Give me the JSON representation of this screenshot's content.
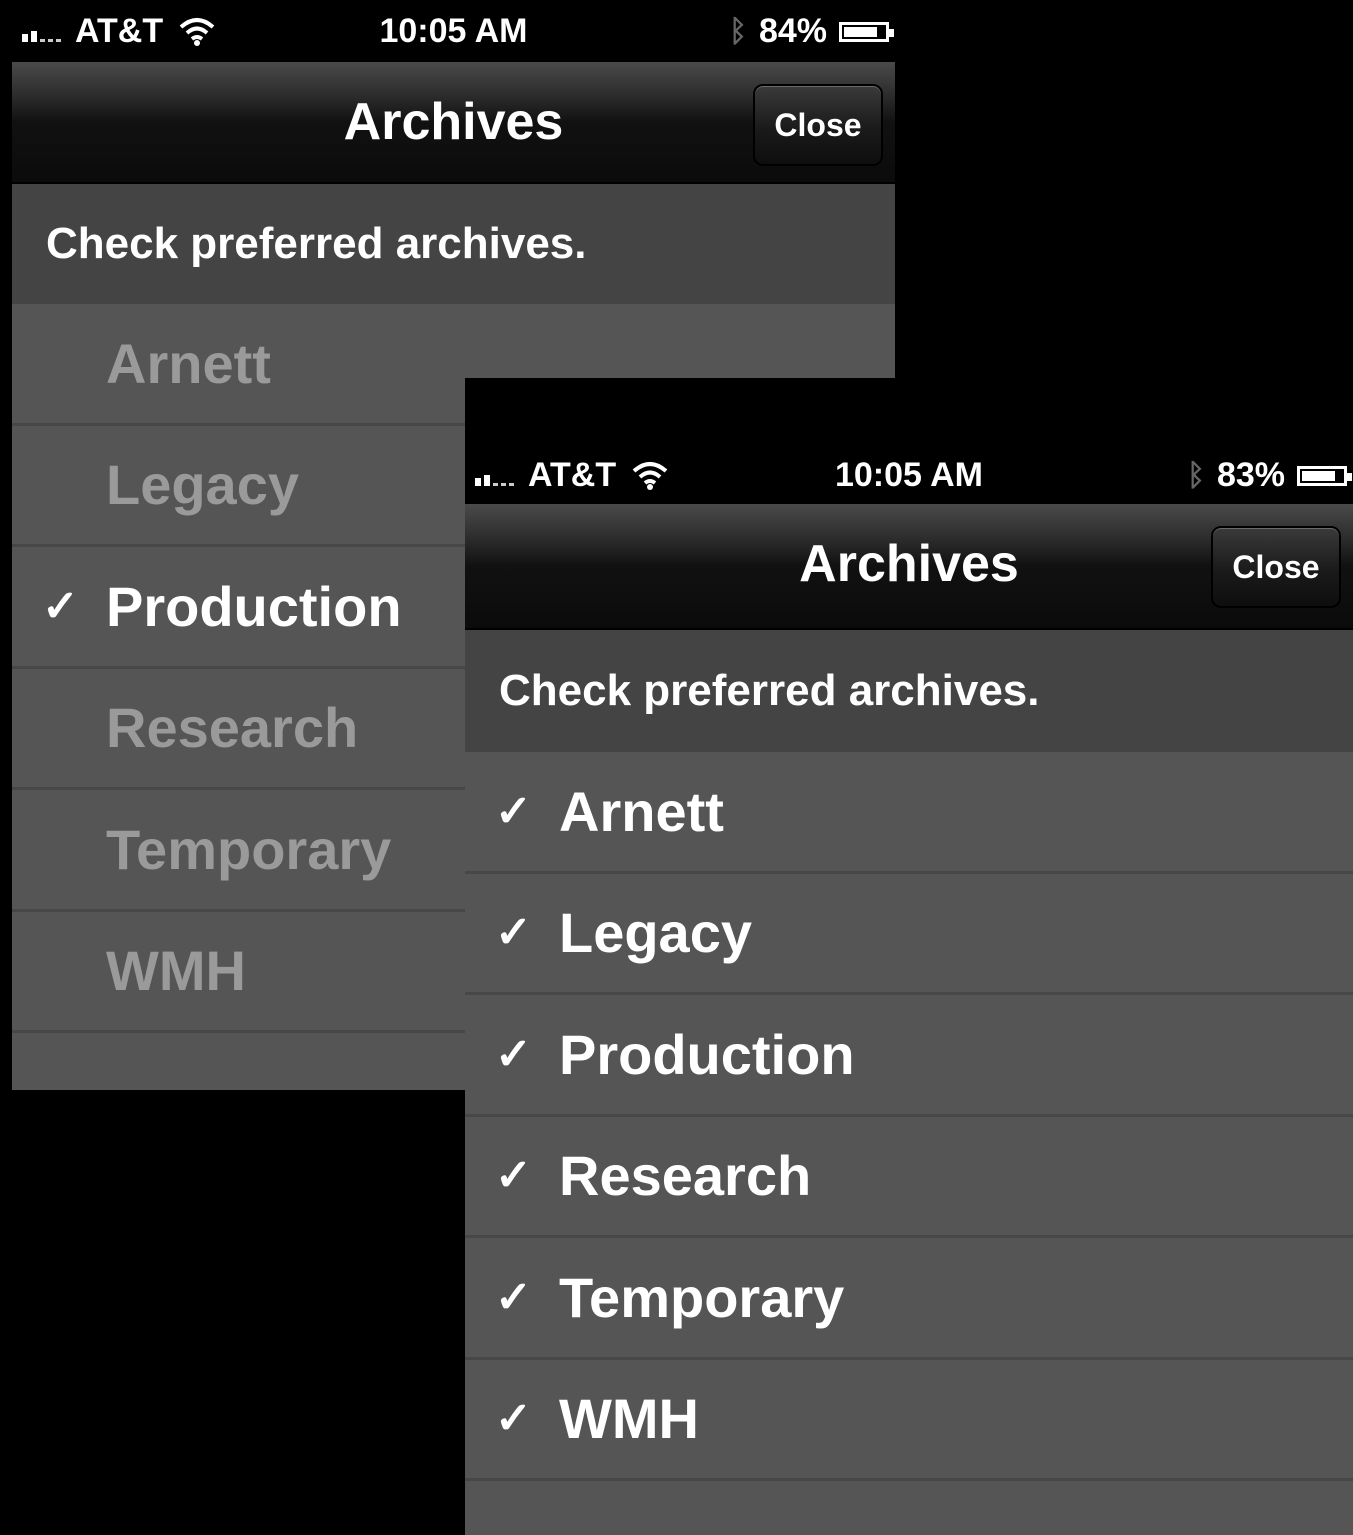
{
  "screens": [
    {
      "status": {
        "carrier": "AT&T",
        "time": "10:05 AM",
        "battery": "84%",
        "battery_level": 0.84
      },
      "nav": {
        "title": "Archives",
        "close_label": "Close"
      },
      "instruction": "Check preferred archives.",
      "check_glyph": "✓",
      "items": [
        {
          "label": "Arnett",
          "checked": false
        },
        {
          "label": "Legacy",
          "checked": false
        },
        {
          "label": "Production",
          "checked": true
        },
        {
          "label": "Research",
          "checked": false
        },
        {
          "label": "Temporary",
          "checked": false
        },
        {
          "label": "WMH",
          "checked": false
        }
      ]
    },
    {
      "status": {
        "carrier": "AT&T",
        "time": "10:05 AM",
        "battery": "83%",
        "battery_level": 0.83
      },
      "nav": {
        "title": "Archives",
        "close_label": "Close"
      },
      "instruction": "Check preferred archives.",
      "check_glyph": "✓",
      "items": [
        {
          "label": "Arnett",
          "checked": true
        },
        {
          "label": "Legacy",
          "checked": true
        },
        {
          "label": "Production",
          "checked": true
        },
        {
          "label": "Research",
          "checked": true
        },
        {
          "label": "Temporary",
          "checked": true
        },
        {
          "label": "WMH",
          "checked": true
        }
      ]
    }
  ],
  "icons": {
    "signal": "signal-bars-icon",
    "wifi": "wifi-icon",
    "bluetooth": "bluetooth-icon",
    "battery": "battery-icon",
    "check": "checkmark-icon"
  }
}
